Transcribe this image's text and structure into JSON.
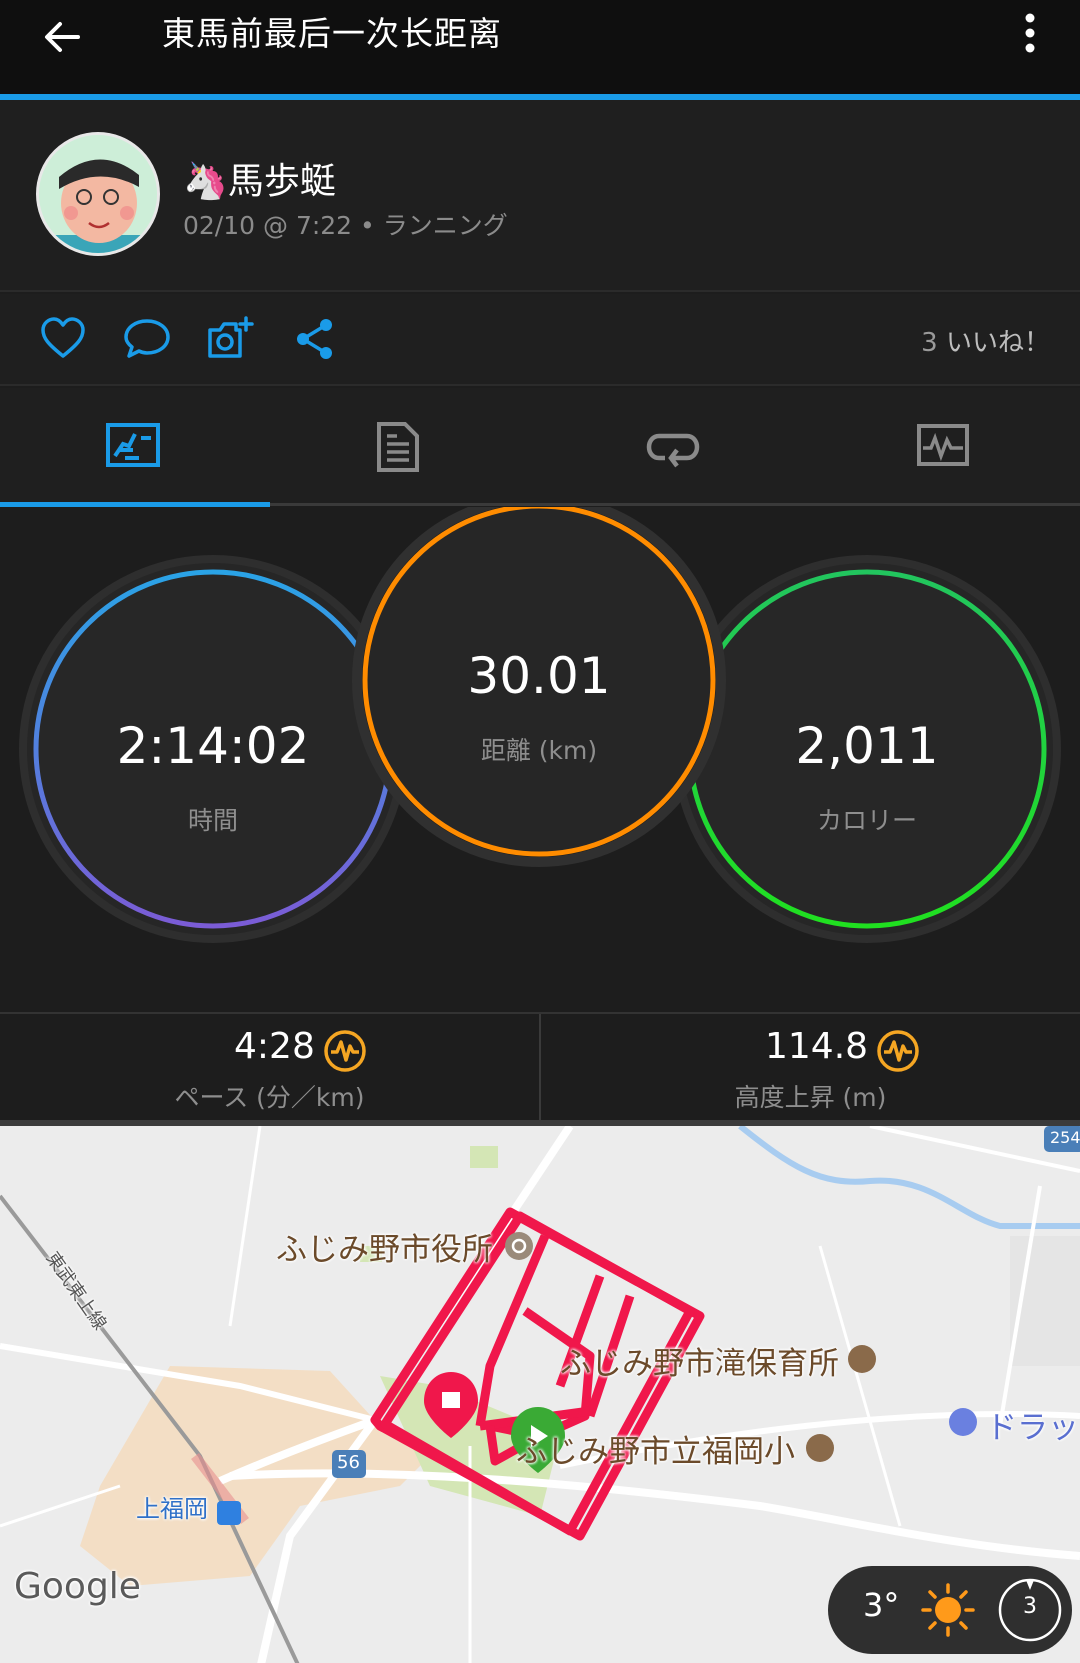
{
  "header": {
    "title": "東馬前最后一次长距离",
    "back_icon": "arrow-left-icon",
    "more_icon": "more-vertical-icon"
  },
  "profile": {
    "name": "🦄馬歩蜓",
    "meta": "02/10 @ 7:22 • ランニング"
  },
  "actions": {
    "likes_count": "3",
    "likes_label": "いいね！"
  },
  "tabs": [
    {
      "name": "summary",
      "icon": "stats-icon",
      "active": true
    },
    {
      "name": "details",
      "icon": "document-icon",
      "active": false
    },
    {
      "name": "laps",
      "icon": "loop-icon",
      "active": false
    },
    {
      "name": "charts",
      "icon": "chart-icon",
      "active": false
    }
  ],
  "stats": {
    "time": {
      "value": "2:14:02",
      "label": "時間"
    },
    "distance": {
      "value": "30.01",
      "label": "距離 (km)"
    },
    "calories": {
      "value": "2,011",
      "label": "カロリー"
    }
  },
  "substats": {
    "pace": {
      "value": "4:28",
      "label": "ペース (分／km)"
    },
    "elevation": {
      "value": "114.8",
      "label": "高度上昇 (m)"
    }
  },
  "map": {
    "labels": {
      "city_hall": "ふじみ野市役所",
      "nursery": "ふじみ野市滝保育所",
      "school": "ふじみ野市立福岡小",
      "station": "上福岡",
      "drug": "ドラッ",
      "railway": "東武東上線",
      "route56": "56",
      "route254": "254",
      "google": "Google"
    },
    "weather": {
      "temp": "3°",
      "wind": "3"
    }
  },
  "colors": {
    "accent": "#1a9be8",
    "route": "#f0174b",
    "time_ring": "#2e9be6",
    "distance_ring": "#ff8c00",
    "calorie_ring": "#19d34a"
  }
}
